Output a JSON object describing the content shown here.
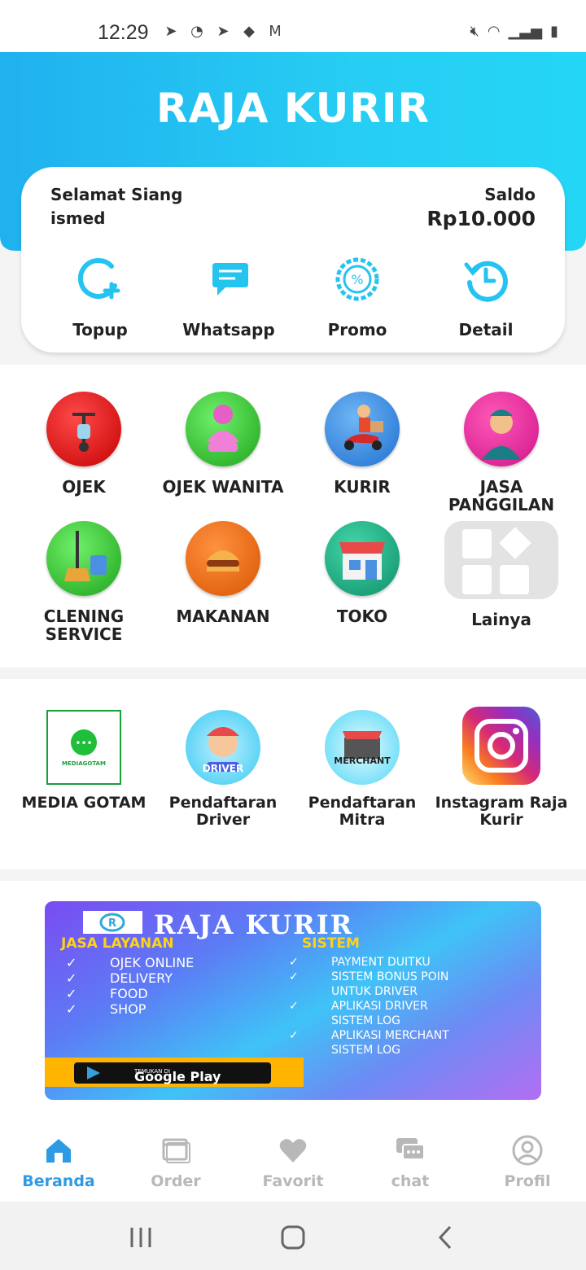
{
  "status_bar": {
    "time": "12:29"
  },
  "header": {
    "title": "RAJA KURIR"
  },
  "account": {
    "greeting": "Selamat Siang",
    "username": "ismed",
    "saldo_label": "Saldo",
    "saldo_value": "Rp10.000"
  },
  "quick_actions": [
    {
      "label": "Topup",
      "icon": "topup-icon"
    },
    {
      "label": "Whatsapp",
      "icon": "whatsapp-icon"
    },
    {
      "label": "Promo",
      "icon": "promo-icon"
    },
    {
      "label": "Detail",
      "icon": "history-icon"
    }
  ],
  "services": [
    {
      "label": "OJEK"
    },
    {
      "label": "OJEK WANITA"
    },
    {
      "label": "KURIR"
    },
    {
      "label": "JASA PANGGILAN"
    },
    {
      "label": "CLENING SERVICE"
    },
    {
      "label": "MAKANAN"
    },
    {
      "label": "TOKO"
    },
    {
      "label": "Lainya"
    }
  ],
  "links": [
    {
      "label": "MEDIA GOTAM",
      "logo_text": "MEDIAGOTAM"
    },
    {
      "label": "Pendaftaran Driver",
      "logo_text": "DRIVER"
    },
    {
      "label": "Pendaftaran Mitra",
      "logo_text": "MERCHANT"
    },
    {
      "label": "Instagram Raja Kurir"
    }
  ],
  "banner": {
    "brand": "RAJA KURIR",
    "heading_left": "JASA LAYANAN",
    "heading_right": "SISTEM",
    "services": [
      "OJEK ONLINE",
      "DELIVERY",
      "FOOD",
      "SHOP"
    ],
    "system": [
      "PAYMENT DUITKU",
      "SISTEM BONUS POIN",
      "UNTUK DRIVER",
      "APLIKASI DRIVER",
      "SISTEM LOG",
      "APLIKASI MERCHANT",
      "SISTEM LOG"
    ],
    "store_small": "TEMUKAN DI",
    "store_name": "Google Play"
  },
  "bottom_nav": [
    {
      "label": "Beranda",
      "active": true
    },
    {
      "label": "Order",
      "active": false
    },
    {
      "label": "Favorit",
      "active": false
    },
    {
      "label": "chat",
      "active": false
    },
    {
      "label": "Profil",
      "active": false
    }
  ],
  "colors": {
    "primary": "#22c3f2",
    "active_nav": "#2e9ae4",
    "inactive_nav": "#b8b8b8"
  }
}
